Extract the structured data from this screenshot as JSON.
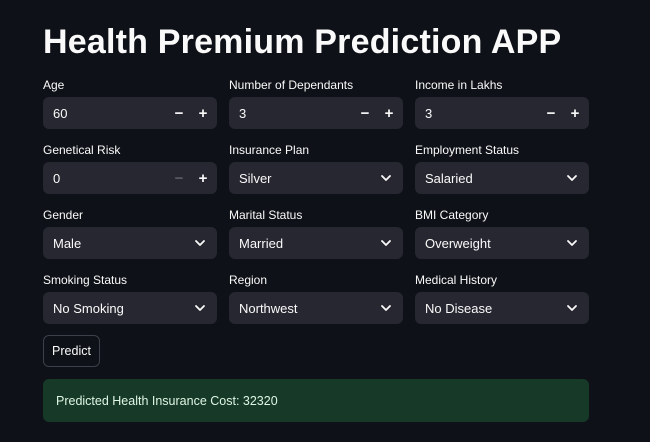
{
  "title": "Health Premium Prediction APP",
  "fields": [
    {
      "label": "Age",
      "value": "60",
      "kind": "number",
      "minus_disabled": false
    },
    {
      "label": "Number of Dependants",
      "value": "3",
      "kind": "number",
      "minus_disabled": false
    },
    {
      "label": "Income in Lakhs",
      "value": "3",
      "kind": "number",
      "minus_disabled": false
    },
    {
      "label": "Genetical Risk",
      "value": "0",
      "kind": "number",
      "minus_disabled": true
    },
    {
      "label": "Insurance Plan",
      "value": "Silver",
      "kind": "select"
    },
    {
      "label": "Employment Status",
      "value": "Salaried",
      "kind": "select"
    },
    {
      "label": "Gender",
      "value": "Male",
      "kind": "select"
    },
    {
      "label": "Marital Status",
      "value": "Married",
      "kind": "select"
    },
    {
      "label": "BMI Category",
      "value": "Overweight",
      "kind": "select"
    },
    {
      "label": "Smoking Status",
      "value": "No Smoking",
      "kind": "select"
    },
    {
      "label": "Region",
      "value": "Northwest",
      "kind": "select"
    },
    {
      "label": "Medical History",
      "value": "No Disease",
      "kind": "select"
    }
  ],
  "stepper": {
    "minus": "−",
    "plus": "+"
  },
  "predict_button": "Predict",
  "result_text": "Predicted Health Insurance Cost: 32320",
  "colors": {
    "background": "#0e1117",
    "input_bg": "#262730",
    "success_bg": "#173928",
    "text": "#fafafa"
  },
  "icons": {
    "select": "chevron-down-icon"
  }
}
